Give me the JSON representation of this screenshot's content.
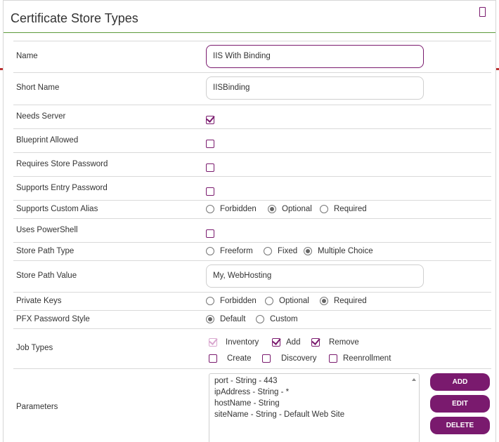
{
  "dialog": {
    "title": "Certificate Store Types"
  },
  "fields": {
    "name": {
      "label": "Name",
      "value": "IIS With Binding"
    },
    "short_name": {
      "label": "Short Name",
      "value": "IISBinding"
    },
    "needs_server": {
      "label": "Needs Server",
      "checked": true
    },
    "blueprint_allowed": {
      "label": "Blueprint Allowed",
      "checked": false
    },
    "requires_store_password": {
      "label": "Requires Store Password",
      "checked": false
    },
    "supports_entry_password": {
      "label": "Supports Entry Password",
      "checked": false
    },
    "supports_custom_alias": {
      "label": "Supports Custom Alias",
      "options": [
        "Forbidden",
        "Optional",
        "Required"
      ],
      "selected": "Optional"
    },
    "uses_powershell": {
      "label": "Uses PowerShell",
      "checked": false
    },
    "store_path_type": {
      "label": "Store Path Type",
      "options": [
        "Freeform",
        "Fixed",
        "Multiple Choice"
      ],
      "selected": "Multiple Choice"
    },
    "store_path_value": {
      "label": "Store Path Value",
      "value": "My, WebHosting"
    },
    "private_keys": {
      "label": "Private Keys",
      "options": [
        "Forbidden",
        "Optional",
        "Required"
      ],
      "selected": "Required"
    },
    "pfx_password_style": {
      "label": "PFX Password Style",
      "options": [
        "Default",
        "Custom"
      ],
      "selected": "Default"
    },
    "job_types": {
      "label": "Job Types",
      "items": [
        "Inventory",
        "Add",
        "Remove",
        "Create",
        "Discovery",
        "Reenrollment"
      ]
    },
    "parameters": {
      "label": "Parameters",
      "items": [
        "port - String - 443",
        "ipAddress - String - *",
        "hostName - String",
        "siteName - String - Default Web Site"
      ],
      "buttons": {
        "add": "ADD",
        "edit": "EDIT",
        "delete": "DELETE"
      }
    }
  },
  "colors": {
    "accent": "#7a1a6e",
    "header_rule": "#5c9a3a"
  }
}
